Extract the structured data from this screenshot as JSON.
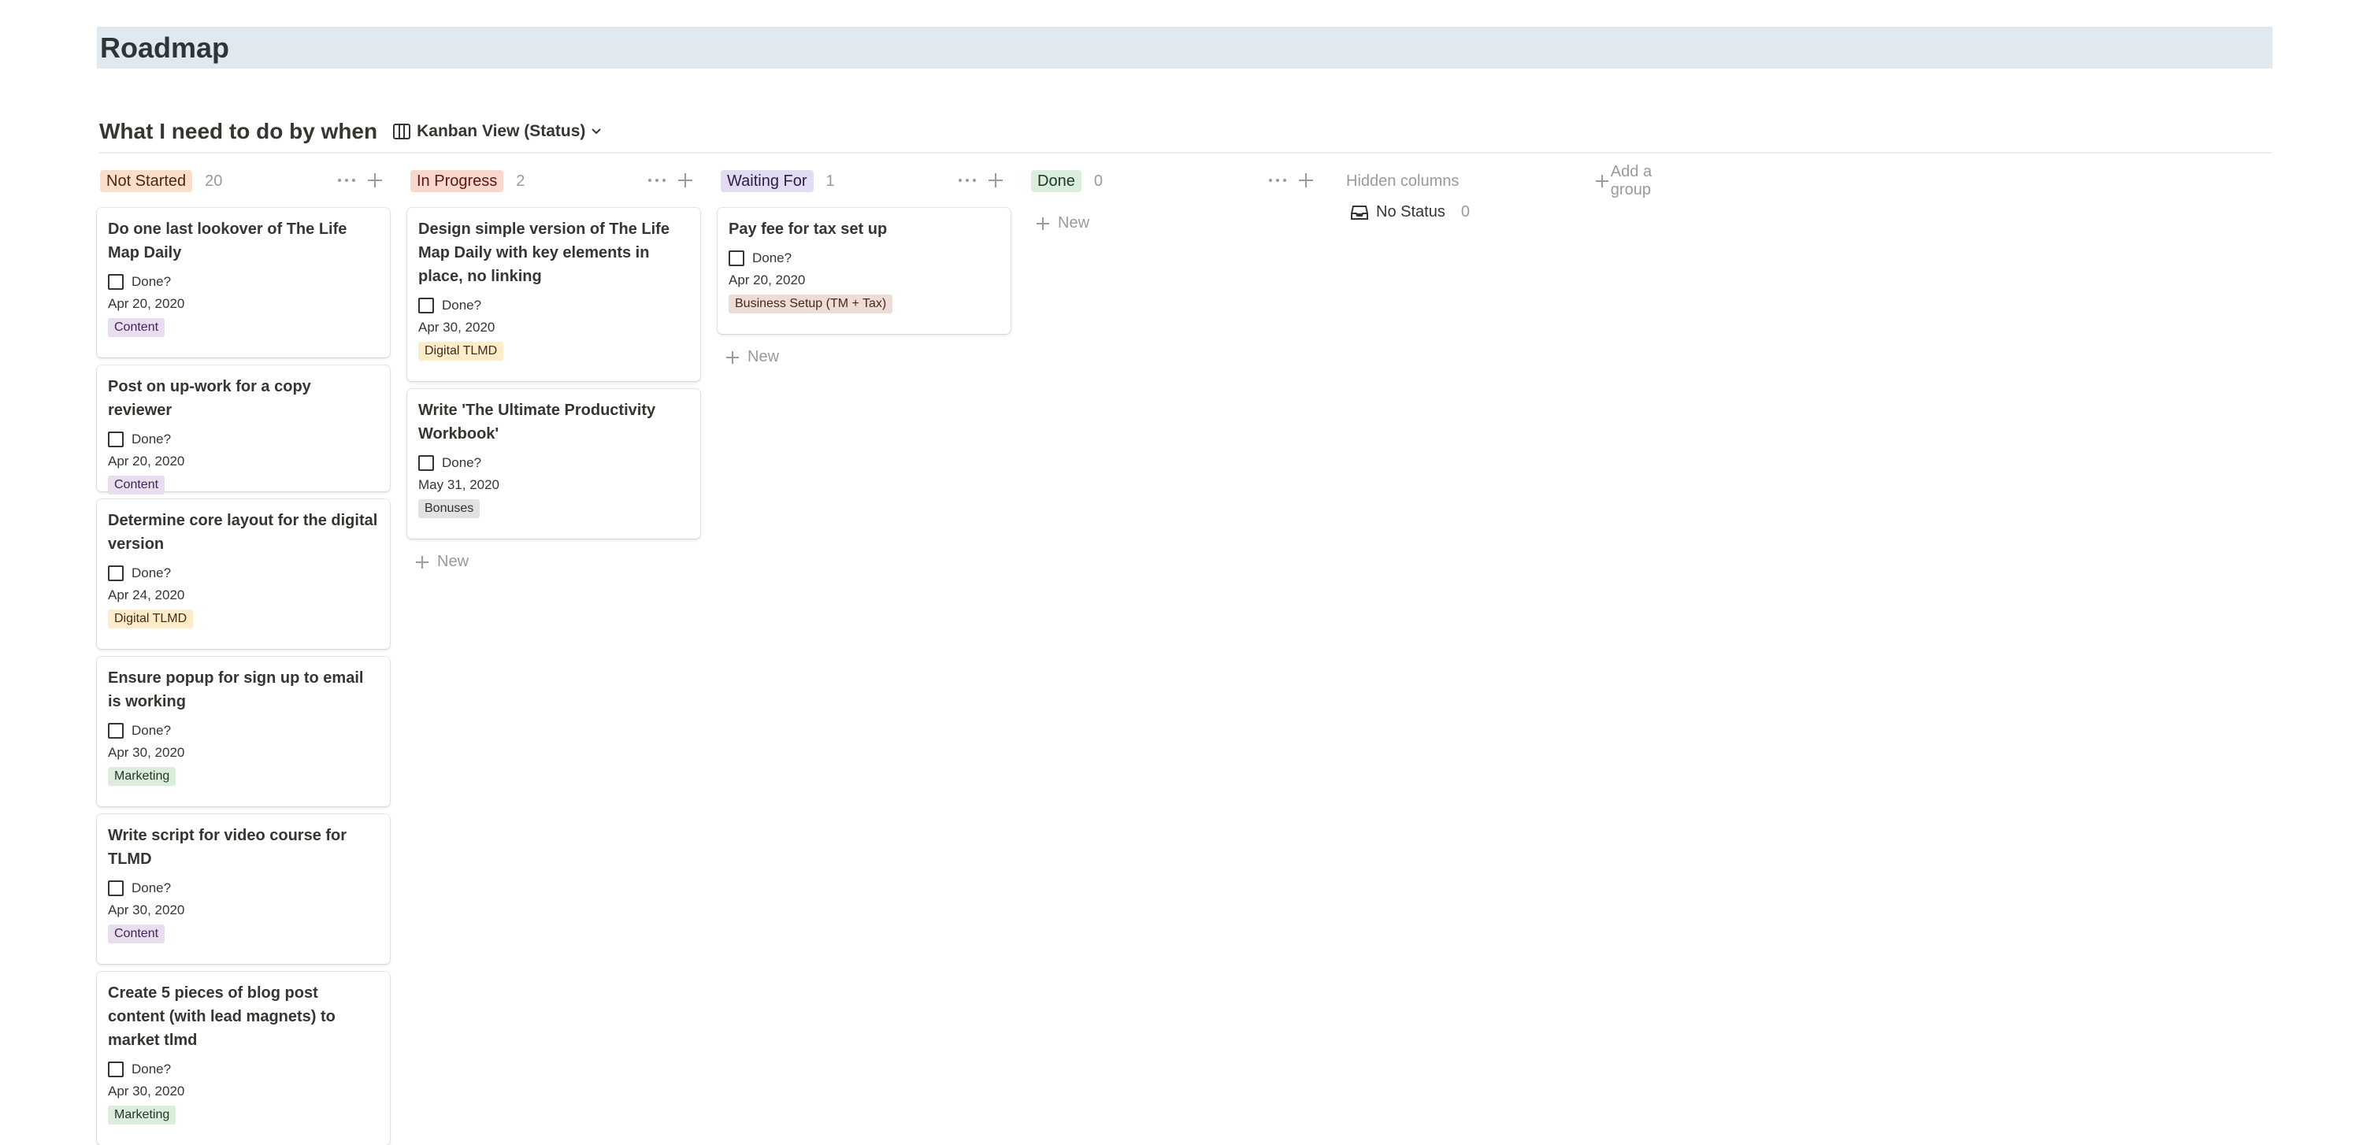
{
  "page": {
    "title": "Roadmap"
  },
  "database": {
    "title": "What I need to do by when",
    "view_label": "Kanban View (Status)"
  },
  "colors": {
    "banner": "#dfe9ef",
    "not_started": "#fadec9",
    "in_progress": "#f9d7cc",
    "waiting_for": "#e2dcf2",
    "done": "#dbeddb",
    "tag_content": "#e8deee",
    "tag_digital_tlmd": "#fdecc8",
    "tag_marketing": "#dbeddb",
    "tag_bonuses": "#e3e2e0",
    "tag_business_setup": "#eedcd6"
  },
  "columns": [
    {
      "label": "Not Started",
      "count": "20",
      "cards": [
        {
          "title": "Do one last lookover of The Life Map Daily",
          "done_label": "Done?",
          "date": "Apr 20, 2020",
          "tag": "Content"
        },
        {
          "title": "Post on up-work for a copy reviewer",
          "done_label": "Done?",
          "date": "Apr 20, 2020",
          "tag": "Content"
        },
        {
          "title": "Determine core layout for the digital version",
          "done_label": "Done?",
          "date": "Apr 24, 2020",
          "tag": "Digital TLMD"
        },
        {
          "title": "Ensure popup for sign up to email is working",
          "done_label": "Done?",
          "date": "Apr 30, 2020",
          "tag": "Marketing"
        },
        {
          "title": "Write script for video course for TLMD",
          "done_label": "Done?",
          "date": "Apr 30, 2020",
          "tag": "Content"
        },
        {
          "title": "Create 5 pieces of blog post content (with lead magnets) to market tlmd",
          "done_label": "Done?",
          "date": "Apr 30, 2020",
          "tag": "Marketing"
        }
      ]
    },
    {
      "label": "In Progress",
      "count": "2",
      "new_label": "New",
      "cards": [
        {
          "title": "Design simple version of The Life Map Daily with key elements in place, no linking",
          "done_label": "Done?",
          "date": "Apr 30, 2020",
          "tag": "Digital TLMD"
        },
        {
          "title": "Write 'The Ultimate Productivity Workbook'",
          "done_label": "Done?",
          "date": "May 31, 2020",
          "tag": "Bonuses"
        }
      ]
    },
    {
      "label": "Waiting For",
      "count": "1",
      "new_label": "New",
      "cards": [
        {
          "title": "Pay fee for tax set up",
          "done_label": "Done?",
          "date": "Apr 20, 2020",
          "tag": "Business Setup (TM + Tax)"
        }
      ]
    },
    {
      "label": "Done",
      "count": "0",
      "new_label": "New",
      "cards": []
    }
  ],
  "hidden_columns": {
    "title": "Hidden columns",
    "items": [
      {
        "label": "No Status",
        "count": "0"
      }
    ]
  },
  "add_group_label": "Add a group"
}
